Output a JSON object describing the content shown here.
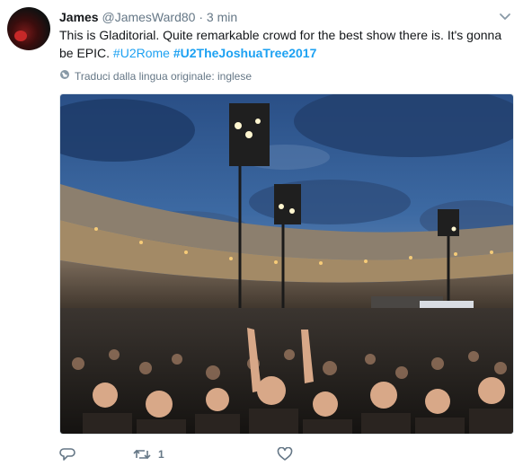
{
  "tweet": {
    "name": "James",
    "handle": "@JamesWard80",
    "separator": "·",
    "time": "3 min",
    "text_plain": "This is Gladitorial. Quite remarkable crowd for the best show there is. It's gonna be EPIC.",
    "hashtag_1": "#U2Rome",
    "hashtag_2": "#U2TheJoshuaTree2017",
    "translate_label": "Traduci dalla lingua originale: inglese",
    "retweet_count": "1"
  },
  "icons": {
    "caret": "chevron-down-icon",
    "globe": "globe-icon",
    "reply": "reply-icon",
    "retweet": "retweet-icon",
    "like": "heart-icon"
  },
  "colors": {
    "link": "#1da1f2",
    "secondary_text": "#657786",
    "primary_text": "#14171a"
  }
}
